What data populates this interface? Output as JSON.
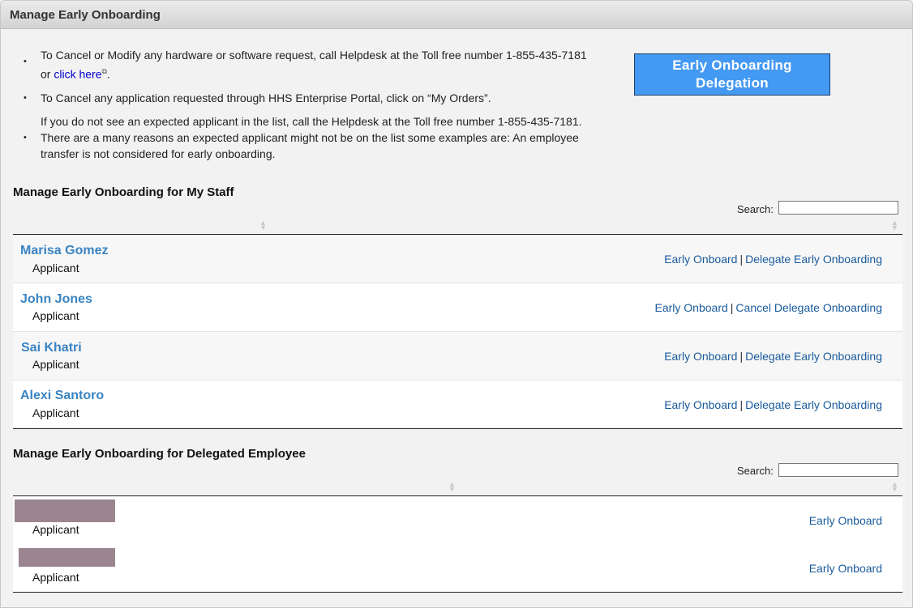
{
  "header": {
    "title": "Manage Early Onboarding"
  },
  "instructions": {
    "item1_text": "To Cancel or Modify any hardware or software request, call Helpdesk at the Toll free number 1-855-435-7181 or",
    "item1_link": "click here",
    "item1_after": ".",
    "item2_text": "To Cancel any application requested through HHS Enterprise Portal, click on “My Orders”.",
    "item3_line1": "If you do not see an expected applicant in the list, call the Helpdesk at the Toll free number 1-855-435-7181.",
    "item3_line2": "There are a many reasons an expected applicant might not be on the list some examples are: An employee transfer is not considered for early onboarding.",
    "bullet": "•"
  },
  "delegation_button": {
    "line1": "Early Onboarding",
    "line2": "Delegation"
  },
  "my_staff": {
    "title": "Manage Early Onboarding for My Staff",
    "search_label": "Search:",
    "search_value": "",
    "rows": [
      {
        "name": "Marisa Gomez",
        "role": "Applicant",
        "action1": "Early Onboard",
        "sep": "|",
        "action2": "Delegate Early Onboarding"
      },
      {
        "name": "John Jones",
        "role": "Applicant",
        "action1": "Early Onboard",
        "sep": "|",
        "action2": "Cancel Delegate Onboarding"
      },
      {
        "name": "Sai Khatri",
        "role": "Applicant",
        "action1": "Early Onboard",
        "sep": "|",
        "action2": "Delegate Early Onboarding"
      },
      {
        "name": "Alexi Santoro",
        "role": "Applicant",
        "action1": "Early Onboard",
        "sep": "|",
        "action2": "Delegate Early Onboarding"
      }
    ]
  },
  "delegated": {
    "title": "Manage Early Onboarding for Delegated Employee",
    "search_label": "Search:",
    "search_value": "",
    "rows": [
      {
        "role": "Applicant",
        "action1": "Early Onboard"
      },
      {
        "role": "Applicant",
        "action1": "Early Onboard"
      }
    ]
  },
  "icons": {
    "sort": "sort-arrows-icon",
    "external": "external-link-icon"
  },
  "colors": {
    "button": "#4499f2",
    "name_link": "#3a84c2",
    "action_link": "#1a5b9c",
    "redaction": "#9b8591"
  }
}
